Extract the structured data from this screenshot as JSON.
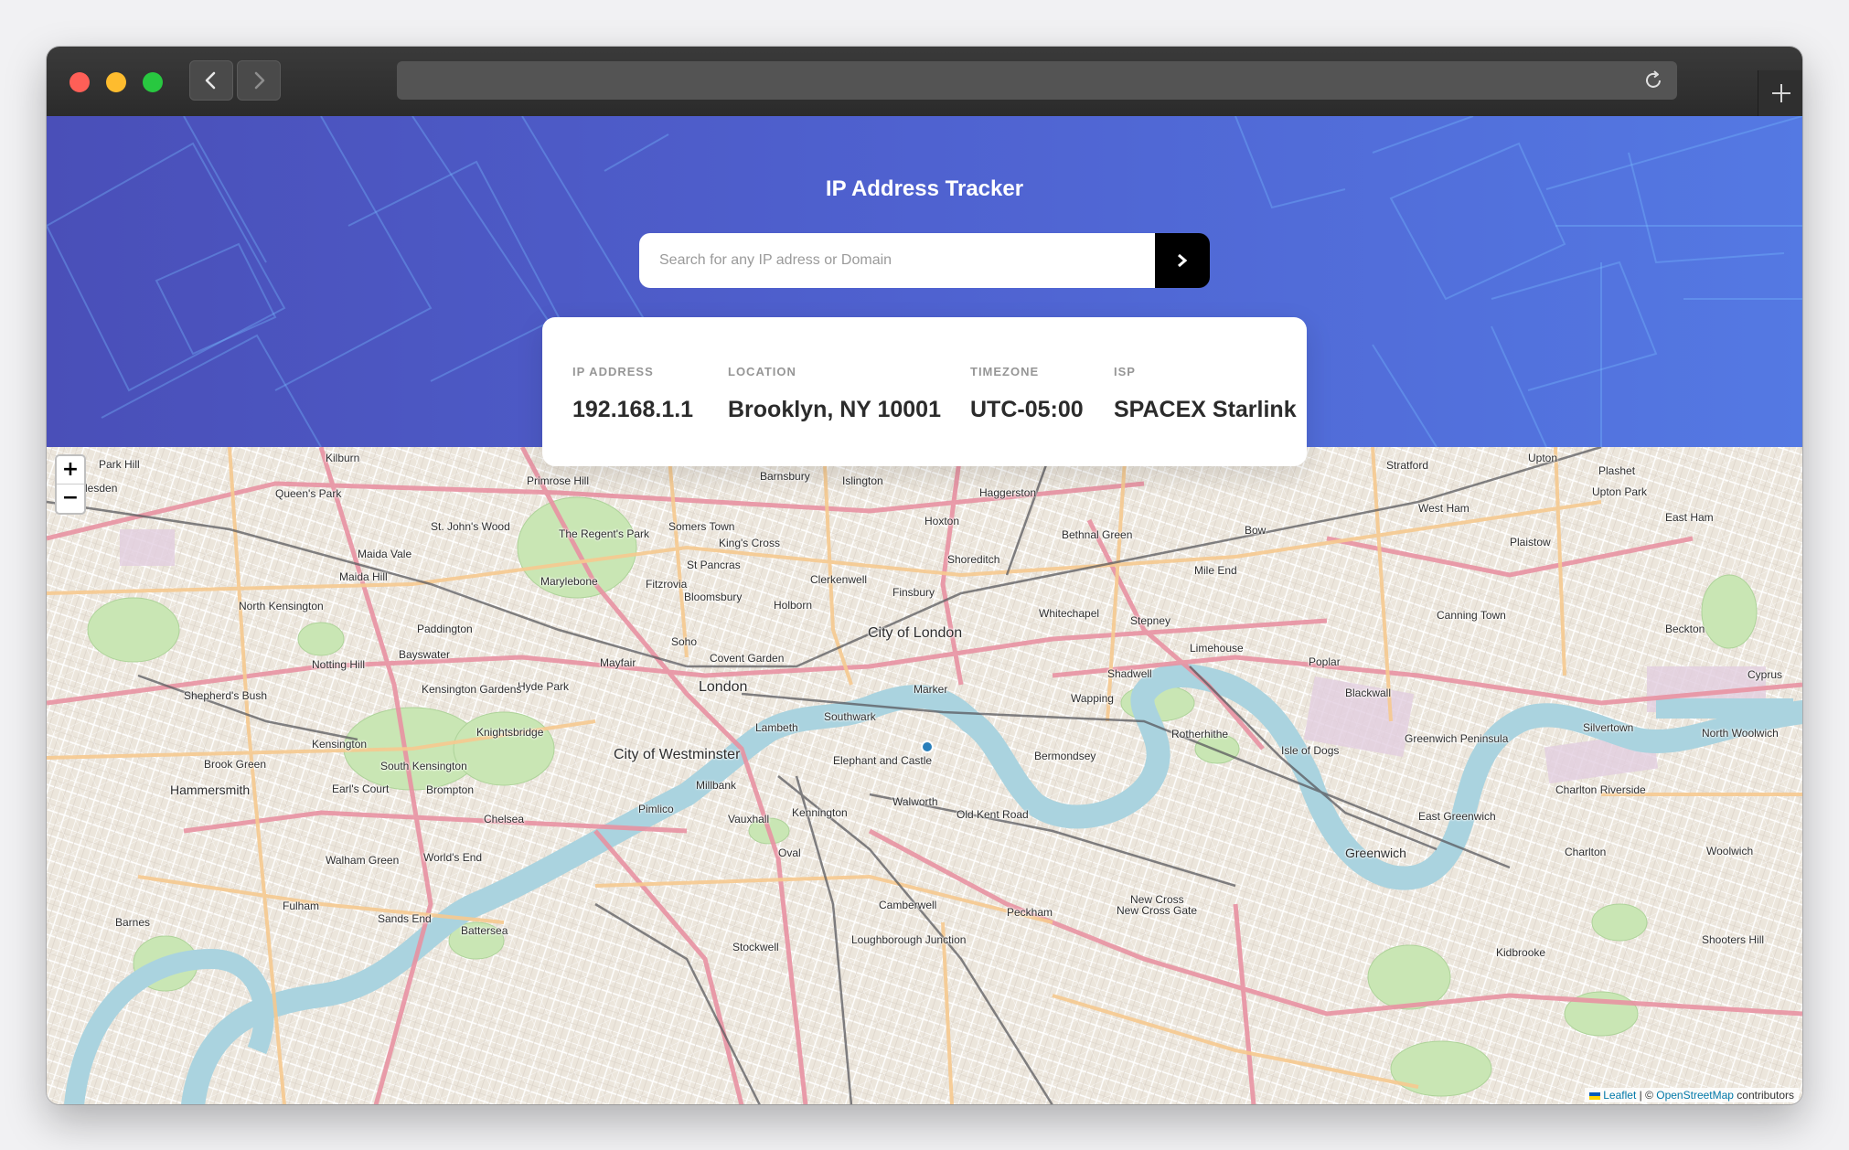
{
  "app": {
    "title": "IP Address Tracker",
    "search": {
      "placeholder": "Search for any IP adress or Domain",
      "value": "",
      "button_icon": "chevron-right-icon"
    },
    "info": {
      "ip_label": "IP ADDRESS",
      "ip_value": "192.168.1.1",
      "location_label": "LOCATION",
      "location_value": "Brooklyn, NY 10001",
      "timezone_label": "TIMEZONE",
      "timezone_value": "UTC-05:00",
      "isp_label": "ISP",
      "isp_value": "SPACEX Starlink"
    }
  },
  "browser": {
    "url": "",
    "buttons": [
      "back",
      "forward",
      "reload",
      "new-tab"
    ]
  },
  "map": {
    "zoom_in": "+",
    "zoom_out": "−",
    "attribution": {
      "leaflet": "Leaflet",
      "separator": " | © ",
      "osm": "OpenStreetMap",
      "suffix": " contributors"
    },
    "places": [
      "Kilburn",
      "Park Hill",
      "Queen's Park",
      "lesden",
      "St. John's Wood",
      "Maida Vale",
      "Maida Hill",
      "North Kensington",
      "Paddington",
      "Notting Hill",
      "Bayswater",
      "Shepherd's Bush",
      "Kensington",
      "Knightsbridge",
      "Brook Green",
      "South Kensington",
      "Hammersmith",
      "Earl's Court",
      "Brompton",
      "Chelsea",
      "Walham Green",
      "World's End",
      "Fulham",
      "Sands End",
      "Barnes",
      "Battersea",
      "Marylebone",
      "Fitzrovia",
      "Bloomsbury",
      "Holborn",
      "Somers Town",
      "King's Cross",
      "St Pancras",
      "Islington",
      "Barnsbury",
      "Clerkenwell",
      "Finsbury",
      "Haggerston",
      "Hoxton",
      "Shoreditch",
      "Bethnal Green",
      "Whitechapel",
      "Stepney",
      "Mile End",
      "Bow",
      "Stratford",
      "West Ham",
      "Upton",
      "Plashet",
      "Upton Park",
      "East Ham",
      "Plaistow",
      "Canning Town",
      "Beckton",
      "Poplar",
      "Limehouse",
      "Shadwell",
      "Wapping",
      "Rotherhithe",
      "Bermondsey",
      "Isle of Dogs",
      "Blackwall",
      "Greenwich Peninsula",
      "Silvertown",
      "North Woolwich",
      "Cyprus",
      "Charlton Riverside",
      "East Greenwich",
      "Greenwich",
      "Charlton",
      "Woolwich",
      "Shooters Hill",
      "Kidbrooke",
      "New Cross",
      "New Cross Gate",
      "Peckham",
      "Camberwell",
      "Walworth",
      "Old Kent Road",
      "Elephant and Castle",
      "Kennington",
      "Oval",
      "Vauxhall",
      "Pimlico",
      "Millbank",
      "Lambeth",
      "Southwark",
      "City of Westminster",
      "London",
      "Soho",
      "Mayfair",
      "Covent Garden",
      "City of London",
      "Stockwell",
      "Loughborough Junction",
      "Hyde Park",
      "Kensington Gardens",
      "The Regent's Park",
      "Primrose Hill",
      "Marker"
    ]
  }
}
